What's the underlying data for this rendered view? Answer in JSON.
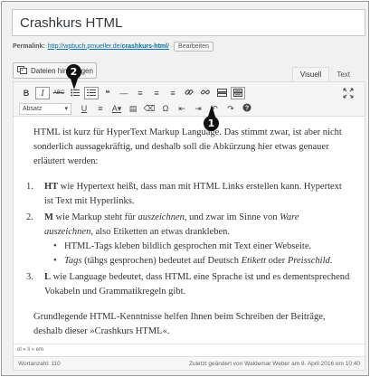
{
  "post": {
    "title": "Crashkurs HTML",
    "permalink_label": "Permalink:",
    "permalink_url": "http://wpbuch.pmueller.de/",
    "permalink_slug": "crashkurs-html",
    "permalink_trailing": "/",
    "edit_label": "Bearbeiten"
  },
  "media": {
    "add_label": "Dateien hinzufügen"
  },
  "tabs": [
    {
      "label": "Visuell",
      "active": true
    },
    {
      "label": "Text",
      "active": false
    }
  ],
  "toolbar": {
    "row1": [
      {
        "name": "bold-button",
        "glyph": "B"
      },
      {
        "name": "italic-button",
        "glyph": "I"
      },
      {
        "name": "strikethrough-button",
        "glyph": "ABC"
      },
      {
        "name": "bulleted-list-button",
        "glyph": "☰"
      },
      {
        "name": "numbered-list-button",
        "glyph": "☰"
      },
      {
        "name": "blockquote-button",
        "glyph": "❝"
      },
      {
        "name": "horizontal-line-button",
        "glyph": "—"
      },
      {
        "name": "align-left-button",
        "glyph": "≡"
      },
      {
        "name": "align-center-button",
        "glyph": "≡"
      },
      {
        "name": "align-right-button",
        "glyph": "≡"
      },
      {
        "name": "insert-link-button",
        "glyph": "🔗"
      },
      {
        "name": "remove-link-button",
        "glyph": "⛓"
      },
      {
        "name": "read-more-button",
        "glyph": "▭"
      },
      {
        "name": "toolbar-toggle-button",
        "glyph": "▦"
      }
    ],
    "format_select": "Absatz",
    "row2": [
      {
        "name": "underline-button",
        "glyph": "U"
      },
      {
        "name": "justify-button",
        "glyph": "≡"
      },
      {
        "name": "text-color-button",
        "glyph": "A"
      },
      {
        "name": "paste-as-text-button",
        "glyph": "▤"
      },
      {
        "name": "clear-formatting-button",
        "glyph": "⌫"
      },
      {
        "name": "special-character-button",
        "glyph": "Ω"
      },
      {
        "name": "outdent-button",
        "glyph": "⇤"
      },
      {
        "name": "indent-button",
        "glyph": "⇥"
      },
      {
        "name": "undo-button",
        "glyph": "↶"
      },
      {
        "name": "redo-button",
        "glyph": "↷"
      },
      {
        "name": "help-button",
        "glyph": "?"
      }
    ]
  },
  "content": {
    "intro": "HTML ist kurz für HyperText Markup Language. Das stimmt zwar, ist aber nicht sonderlich aussagekräftig, und deshalb soll die Abkürzung hier etwas genauer erläutert werden:",
    "item1_num": "1.",
    "item1_strong": "HT",
    "item1_text": " wie Hypertext heißt, dass man mit HTML Links erstellen kann. Hypertext ist Text mit Hyperlinks.",
    "item2_num": "2.",
    "item2_strong": "M",
    "item2_text_a": " wie Markup steht für ",
    "item2_em1": "auszeichnen",
    "item2_text_b": ", und zwar im Sinne von ",
    "item2_em2": "Ware auszeichnen",
    "item2_text_c": ", also Etiketten an etwas drankleben.",
    "sub1": "HTML-Tags kleben bildlich gesprochen mit Text einer Webseite.",
    "sub2_em": "Tags",
    "sub2_text_a": " (tähgs gesprochen) bedeutet auf Deutsch ",
    "sub2_em2": "Etikett",
    "sub2_text_b": " oder ",
    "sub2_em3": "Preisschild",
    "sub2_text_c": ".",
    "item3_num": "3.",
    "item3_strong": "L",
    "item3_text": " wie Language bedeutet, dass HTML eine Sprache ist und es dementsprechend Vokabeln und Grammatikregeln gibt.",
    "outro": "Grundlegende HTML-Kenntnisse helfen Ihnen beim Schreiben der Beiträge, deshalb dieser »Crashkurs HTML«."
  },
  "pathbar": "ol » li » em",
  "status": {
    "word_count": "Wortanzahl: 110",
    "last_modified": "Zuletzt geändert von Waldemar Weber am 8. April 2016 um 10:40"
  },
  "callouts": {
    "one": "1",
    "two": "2"
  }
}
